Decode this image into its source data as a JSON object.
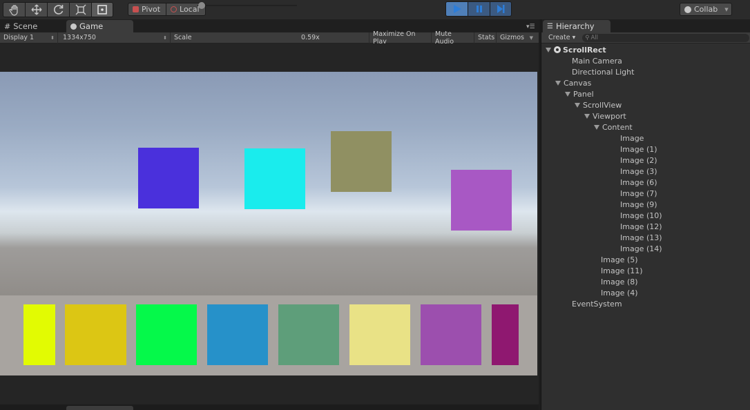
{
  "toolbar": {
    "tools": [
      "hand-tool-icon",
      "move-tool-icon",
      "rotate-tool-icon",
      "scale-tool-icon",
      "rect-tool-icon"
    ],
    "pivot_label": "Pivot",
    "local_label": "Local",
    "collab_label": "Collab"
  },
  "game_panel": {
    "scene_tab": "Scene",
    "game_tab": "Game",
    "display": "Display 1",
    "resolution": "1334x750",
    "scale_label": "Scale",
    "scale_value": "0.59x",
    "scale_fraction": 0.05,
    "maximize_label": "Maximize On Play",
    "mute_label": "Mute Audio",
    "stats_label": "Stats",
    "gizmos_label": "Gizmos"
  },
  "game_view": {
    "floating_squares": [
      "#4a30dc",
      "#1aeced",
      "#909062",
      "#a858c4"
    ],
    "strip_squares": [
      "#e2fb02",
      "#dcc614",
      "#05f94a",
      "#2691c9",
      "#5e9e7a",
      "#e9e286",
      "#9c4fae",
      "#8f1870"
    ]
  },
  "hierarchy": {
    "tab_label": "Hierarchy",
    "create_label": "Create",
    "search_placeholder": "All",
    "items": [
      {
        "label": "ScrollRect",
        "depth": 0,
        "expanded": true,
        "root": true
      },
      {
        "label": "Main Camera",
        "depth": 1
      },
      {
        "label": "Directional Light",
        "depth": 1
      },
      {
        "label": "Canvas",
        "depth": 1,
        "expanded": true
      },
      {
        "label": "Panel",
        "depth": 2,
        "expanded": true
      },
      {
        "label": "ScrollView",
        "depth": 3,
        "expanded": true
      },
      {
        "label": "Viewport",
        "depth": 4,
        "expanded": true
      },
      {
        "label": "Content",
        "depth": 5,
        "expanded": true
      },
      {
        "label": "Image",
        "depth": 6
      },
      {
        "label": "Image (1)",
        "depth": 6
      },
      {
        "label": "Image (2)",
        "depth": 6
      },
      {
        "label": "Image (3)",
        "depth": 6
      },
      {
        "label": "Image (6)",
        "depth": 6
      },
      {
        "label": "Image (7)",
        "depth": 6
      },
      {
        "label": "Image (9)",
        "depth": 6
      },
      {
        "label": "Image (10)",
        "depth": 6
      },
      {
        "label": "Image (12)",
        "depth": 6
      },
      {
        "label": "Image (13)",
        "depth": 6
      },
      {
        "label": "Image (14)",
        "depth": 6
      },
      {
        "label": "Image (5)",
        "depth": 4
      },
      {
        "label": "Image (11)",
        "depth": 4
      },
      {
        "label": "Image (8)",
        "depth": 4
      },
      {
        "label": "Image (4)",
        "depth": 4
      },
      {
        "label": "EventSystem",
        "depth": 1
      }
    ]
  }
}
